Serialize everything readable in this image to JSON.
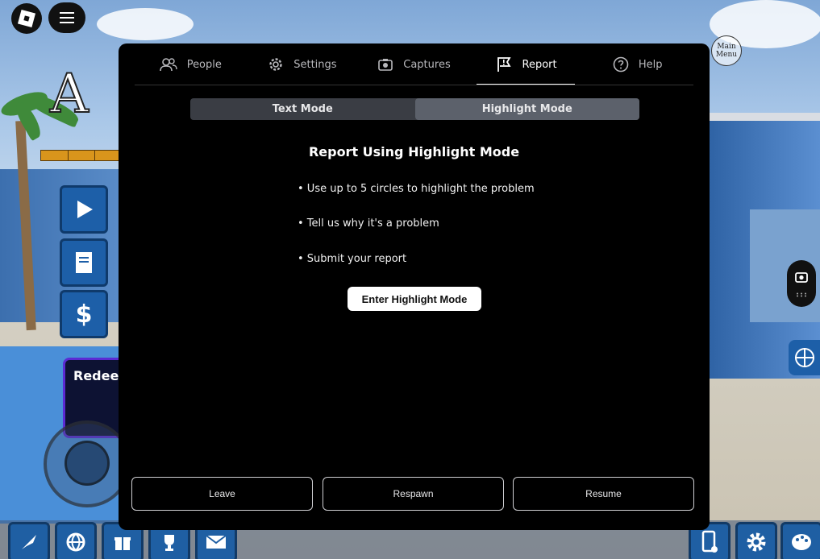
{
  "background": {
    "game_title_fragment": "A R",
    "redeem_label": "Redeem"
  },
  "top_left": {
    "logo_icon": "roblox-logo-icon",
    "menu_icon": "hamburger-menu-icon"
  },
  "main_menu_badge": "Main Menu",
  "tabs": [
    {
      "label": "People",
      "icon": "people-icon"
    },
    {
      "label": "Settings",
      "icon": "gear-icon"
    },
    {
      "label": "Captures",
      "icon": "camera-icon"
    },
    {
      "label": "Report",
      "icon": "flag-icon",
      "active": true
    },
    {
      "label": "Help",
      "icon": "help-icon"
    }
  ],
  "mode_toggle": {
    "text_mode": "Text Mode",
    "highlight_mode": "Highlight Mode",
    "selected": "Highlight Mode"
  },
  "report": {
    "title": "Report Using Highlight Mode",
    "bullets": [
      "• Use up to 5 circles to highlight the problem",
      "• Tell us why it's a problem",
      "• Submit your report"
    ],
    "enter_button": "Enter Highlight Mode"
  },
  "footer": {
    "leave": "Leave",
    "respawn": "Respawn",
    "resume": "Resume"
  },
  "colors": {
    "panel_bg": "#000000",
    "toggle_bg": "#3a3d44",
    "toggle_active": "#5c616b",
    "game_blue": "#1d5fa8"
  }
}
